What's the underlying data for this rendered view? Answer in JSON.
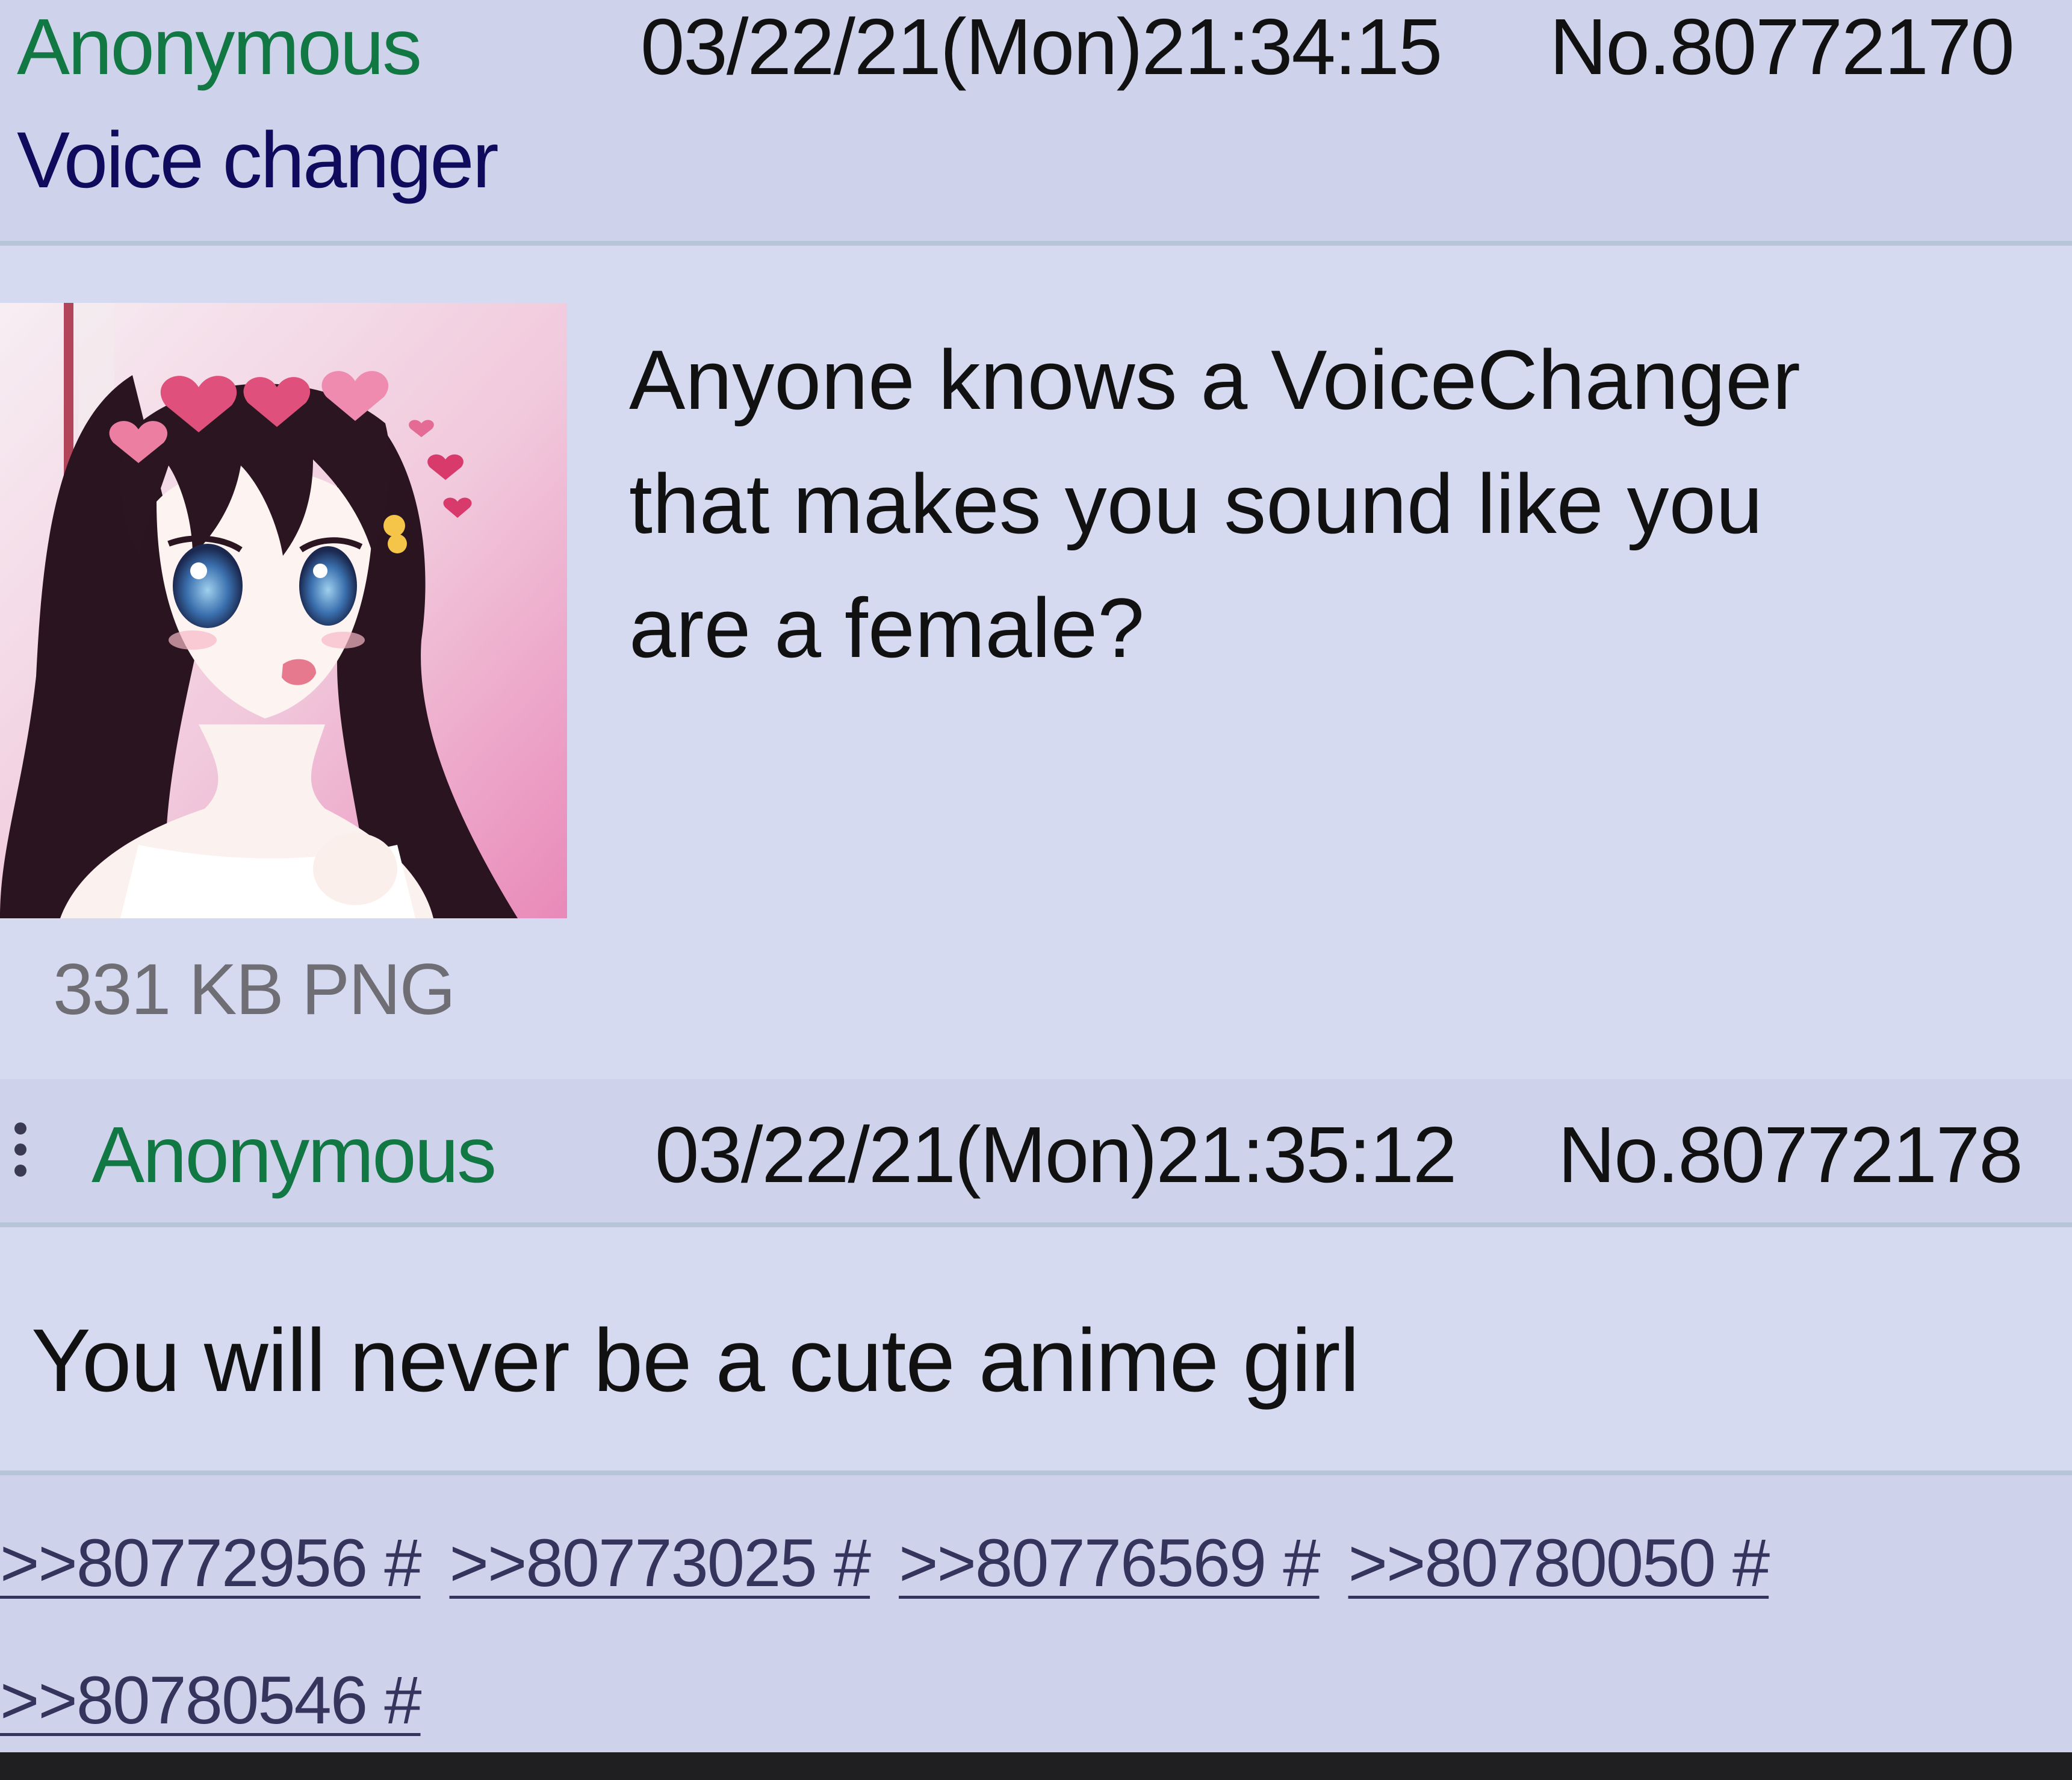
{
  "op": {
    "name": "Anonymous",
    "datetime": "03/22/21(Mon)21:34:15",
    "post_number": "No.80772170",
    "subject": "Voice changer",
    "comment_lines": [
      "Anyone knows a VoiceChanger",
      "that makes you sound like you",
      "are a female?"
    ],
    "file_info": "331 KB PNG"
  },
  "reply": {
    "name": "Anonymous",
    "datetime": "03/22/21(Mon)21:35:12",
    "post_number": "No.80772178",
    "comment": "You will never be a cute anime girl"
  },
  "backlinks": [
    ">>80772956 #",
    ">>80773025 #",
    ">>80776569 #",
    ">>80780050 #",
    ">>80780546 #"
  ],
  "colors": {
    "name_green": "#117743",
    "subject_navy": "#0f0c5d",
    "post_bg": "#d6daf0",
    "header_bg": "#ced2ea",
    "link": "#34345c"
  }
}
